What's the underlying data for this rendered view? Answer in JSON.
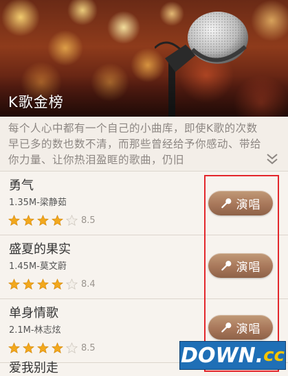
{
  "banner": {
    "title": "K歌金榜"
  },
  "description": {
    "text": "每个人心中都有一个自己的小曲库，即使K歌的次数早已多的数也数不清，而那些曾经给予你感动、带给你力量、让你热泪盈眶的歌曲，仍旧",
    "expand_icon": "double-chevron-down-icon"
  },
  "songs": [
    {
      "title": "勇气",
      "meta": "1.35M-梁静茹",
      "stars": 4,
      "rating": "8.5",
      "button_label": "演唱"
    },
    {
      "title": "盛夏的果实",
      "meta": "1.45M-莫文蔚",
      "stars": 4,
      "rating": "8.4",
      "button_label": "演唱"
    },
    {
      "title": "单身情歌",
      "meta": "2.1M-林志炫",
      "stars": 4,
      "rating": "8.5",
      "button_label": "演唱"
    }
  ],
  "partial_next_title": "爱我别走",
  "colors": {
    "accent_button": "#a8775a",
    "star_full": "#f2a81d",
    "highlight": "#e3262b",
    "watermark_bg": "#1f6fb6",
    "watermark_cc": "#f5c400"
  },
  "watermark": {
    "main": "DOWN",
    "dot": ".",
    "tld": "cc"
  }
}
